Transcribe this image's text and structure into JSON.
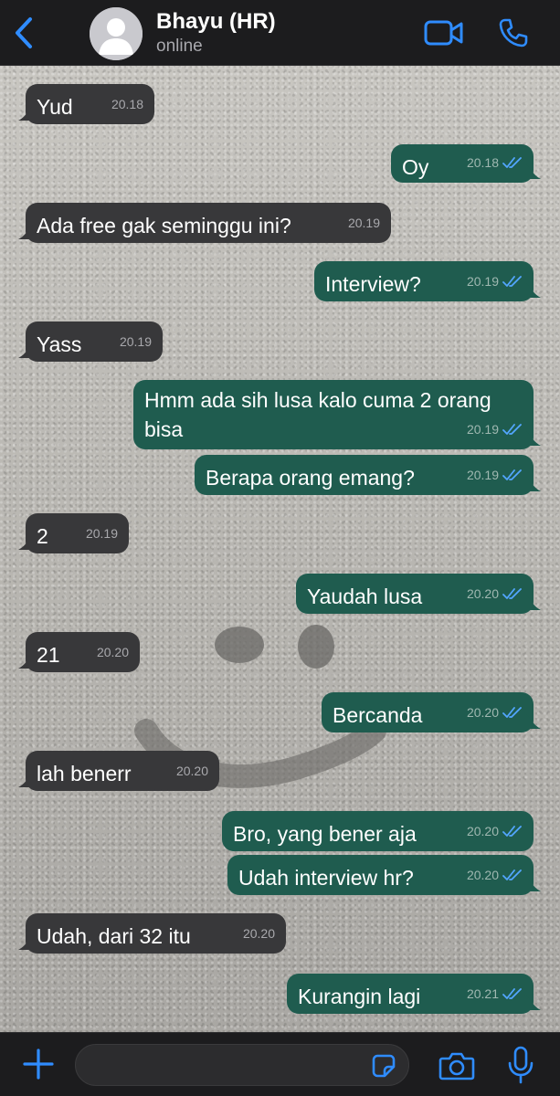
{
  "colors": {
    "accent": "#2f8cff",
    "incoming_bubble": "#38383a",
    "outgoing_bubble": "#1f5c4f",
    "read_tick": "#53a6ff"
  },
  "header": {
    "back_icon": "chevron-left-icon",
    "contact_name": "Bhayu (HR)",
    "status": "online",
    "video_icon": "video-camera-icon",
    "call_icon": "phone-icon"
  },
  "messages": [
    {
      "dir": "in",
      "text": "Yud",
      "time": "20.18"
    },
    {
      "dir": "out",
      "text": "Oy",
      "time": "20.18",
      "status": "read"
    },
    {
      "dir": "in",
      "text": "Ada free gak seminggu ini?",
      "time": "20.19"
    },
    {
      "dir": "out",
      "text": "Interview?",
      "time": "20.19",
      "status": "read"
    },
    {
      "dir": "in",
      "text": "Yass",
      "time": "20.19"
    },
    {
      "dir": "out",
      "text_line1": "Hmm ada sih lusa kalo cuma 2 orang",
      "text_line2": "bisa",
      "time": "20.19",
      "status": "read"
    },
    {
      "dir": "out",
      "text": "Berapa orang emang?",
      "time": "20.19",
      "status": "read"
    },
    {
      "dir": "in",
      "text": "2",
      "time": "20.19"
    },
    {
      "dir": "out",
      "text": "Yaudah lusa",
      "time": "20.20",
      "status": "read"
    },
    {
      "dir": "in",
      "text": "21",
      "time": "20.20"
    },
    {
      "dir": "out",
      "text": "Bercanda",
      "time": "20.20",
      "status": "read"
    },
    {
      "dir": "in",
      "text": "lah benerr",
      "time": "20.20"
    },
    {
      "dir": "out",
      "text": "Bro, yang bener aja",
      "time": "20.20",
      "status": "read"
    },
    {
      "dir": "out",
      "text": "Udah interview hr?",
      "time": "20.20",
      "status": "read"
    },
    {
      "dir": "in",
      "text": "Udah, dari 32 itu",
      "time": "20.20"
    },
    {
      "dir": "out",
      "text": "Kurangin lagi",
      "time": "20.21",
      "status": "read"
    }
  ],
  "input_bar": {
    "plus_icon": "plus-icon",
    "message_value": "",
    "sticker_icon": "sticker-icon",
    "camera_icon": "camera-icon",
    "mic_icon": "microphone-icon"
  }
}
